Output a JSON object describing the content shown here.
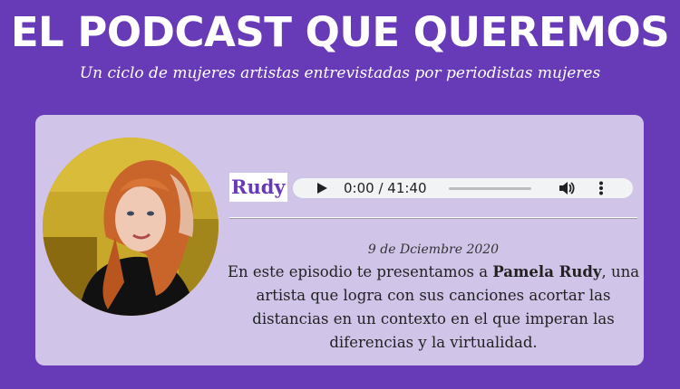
{
  "header": {
    "title": "EL PODCAST QUE QUEREMOS",
    "subtitle": "Un ciclo de mujeres artistas entrevistadas por periodistas mujeres"
  },
  "episode": {
    "name": "Rudy",
    "date": "9 de Dciembre 2020",
    "description_before": "En este episodio te presentamos a ",
    "description_bold": "Pamela Rudy",
    "description_after": ", una artista que logra con sus canciones acortar las distancias en un contexto en el que imperan las diferencias y la virtualidad.",
    "avatar_icon": "portrait-photo",
    "player": {
      "current_time": "0:00",
      "duration": "41:40",
      "time_display": "0:00 / 41:40",
      "progress": 0,
      "icons": [
        "play-icon",
        "volume-icon",
        "more-icon"
      ]
    }
  },
  "colors": {
    "background": "#673ab7",
    "card": "#d1c4e9",
    "accent": "#673ab7",
    "player": "#f1f3f4"
  }
}
